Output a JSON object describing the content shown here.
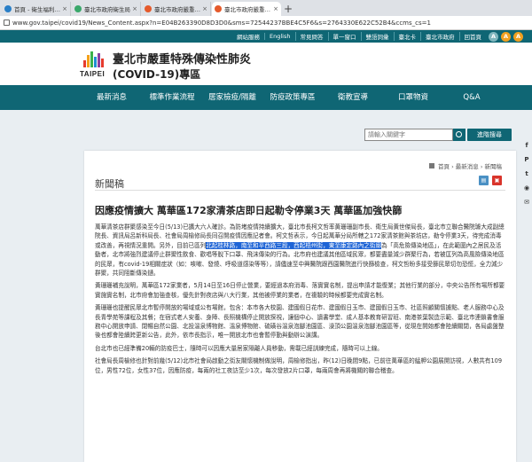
{
  "browser": {
    "tabs": [
      {
        "title": "首頁 - 衛生福利部疾病管制署",
        "color": "#2a7fc7",
        "active": false
      },
      {
        "title": "臺北市政府衛生局",
        "color": "#3aa86b",
        "active": false
      },
      {
        "title": "臺北市政府嚴重特殊傳染性肺炎",
        "color": "#e55a2b",
        "active": false
      },
      {
        "title": "臺北市政府嚴重特殊傳染性肺炎",
        "color": "#e55a2b",
        "active": true
      }
    ],
    "url": "www.gov.taipei/covid19/News_Content.aspx?n=E04B263390D8D3D0&sms=72544237BBE4C5F6&s=2764330E622C52B4&ccms_cs=1"
  },
  "util_nav": {
    "items": [
      "網站服務",
      "English",
      "常見問答",
      "單一窗口",
      "雙語詞彙",
      "臺北卡",
      "臺北市政府",
      "回首頁"
    ],
    "buttons": [
      "A",
      "A",
      "A"
    ]
  },
  "header": {
    "logo_text": "TAIPEI",
    "title": "臺北市嚴重特殊傳染性肺炎",
    "subtitle": "(COVID-19)專區"
  },
  "main_nav": [
    "最新消息",
    "標準作業流程",
    "居家檢疫/隔離",
    "防疫政策專區",
    "衛教宣導",
    "口罩物資",
    "Q&A"
  ],
  "search": {
    "placeholder": "請輸入關鍵字",
    "advanced_label": "進階搜尋"
  },
  "breadcrumb": [
    "首頁",
    "最新消息",
    "新聞稿"
  ],
  "section_title": "新聞稿",
  "article": {
    "headline": "因應疫情擴大 萬華區172家清茶店即日起勒令停業3天 萬華區加強快篩",
    "p1_a": "萬華清茶店群聚感染至今日(5/13)已擴大六人確診。為防堵疫情持續擴大，臺北市長柯文哲率黃珊珊副市長、衛生局黃世傑局長，臺北市立聯合醫院璩大成副總院長、資訊局呂新科局長、社會局周榆修局長同召開疫情因應記者會。",
    "p1_b": "柯文哲表示，今日起萬華分局所轄之172家清茶館與茶坊店，勒令停業3天，待完成消毒或改善，再視情況重開。另外，目前已區列",
    "p1_hl": "北起桂林路，南至和平西路三段，西起梧州街，東至康定路內之街廓",
    "p1_c": "為「高危險傳染地區」，在此範圍內之居民及活動者，北市將強烈建議停止群聚性飲食、歡唱等脫下口罩、飛沫傳染的行為。北市府也建議其他區域民眾，都要盡量減少群聚行為，若被匡列為高風險傳染地區的民眾，有covid-19相關症狀（如：咳嗽、發燒、呼吸道感染等等），請儘速至中興醫院跟西園醫院進行快篩檢查，柯文哲盼多接受篩民眾切勿恐慌，全力減少群聚，共同阻斷傳染鏈。",
    "p2": "黃珊珊補充說明，萬華區172家業者，5月14日至16日停止營業，要經過本府消毒、落實實名制，提出申請才能復業；其他行業的部分，中央公告所有場所都要實施實名制，北市府會加強查核，優先針對夜店與八大行業，其他被停業的業者，在複驗的時候都要完成實名制。",
    "p3": "黃珊珊也提醒民眾北市暫停開放的場域或公有場館，包含：本市各大校園、建國假日花市、建國假日玉市、建國假日玉市、社區照顧關懷據點、老人服務中心及長青學苑等課程及其餐；在宿式老人安養、身障、長照機構停止開放探視，讓個中心、讀書學堂、成人基本教育研習班、南港茶葉製造示範、臺北市連鎖書會服務中心開放申請、閉暢自然公園、北投溫泉博物館、溫泉博物館、硫磺谷溫泉泡腳池園區、澡頂公園溫泉泡腳池園區等，從現在開始都會陸續關閉，各局處盤整後也都會陸續跨更新公告，此外，依市長指示，唯一開放北市也會暫停勤與動辦公演講。",
    "p4": "台北市也已經準備20輛的防疫巴士，隨時可以因應大量居家隔離人員移動，需載已經訓練完成，隨時可以上線。",
    "p5": "社會局長周榆修也針對前幾(5/12)北市社會局啟動之街友關懷機制做說明，周榆修指出，昨(12)日晚間9點，已前往萬華區的艋舺公園展開訪視，人數共有109位，男性72位，女性37位，因應防疫，每兩的社工夜訪至少1次，每次發放2片口罩，每兩周會再將機關的聯合稽查。"
  }
}
